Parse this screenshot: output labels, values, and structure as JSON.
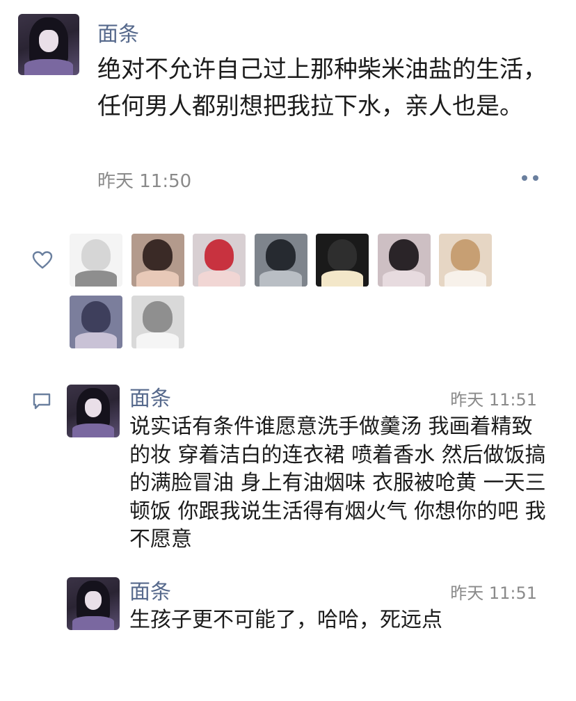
{
  "post": {
    "author": "面条",
    "text": "绝对不允许自己过上那种柴米油盐的生活，任何男人都别想把我拉下水，亲人也是。",
    "time": "昨天 11:50"
  },
  "likes": {
    "icon": "heart-outline-icon",
    "avatars": [
      {
        "name": "like-avatar-1",
        "colors": [
          "#f4f4f4",
          "#d6d6d6",
          "#8e8e8e"
        ]
      },
      {
        "name": "like-avatar-2",
        "colors": [
          "#b39a8c",
          "#3a2a26",
          "#e8c9b8"
        ]
      },
      {
        "name": "like-avatar-3",
        "colors": [
          "#d8cfd2",
          "#c8323f",
          "#f1d6d4"
        ]
      },
      {
        "name": "like-avatar-4",
        "colors": [
          "#7e848c",
          "#262a30",
          "#b9bec4"
        ]
      },
      {
        "name": "like-avatar-5",
        "colors": [
          "#1a1a1a",
          "#2e2e2e",
          "#f3e7c9"
        ]
      },
      {
        "name": "like-avatar-6",
        "colors": [
          "#cdbfc3",
          "#2a2428",
          "#e7dbdf"
        ]
      },
      {
        "name": "like-avatar-7",
        "colors": [
          "#e6d6c4",
          "#c79f73",
          "#f7f1ea"
        ]
      },
      {
        "name": "like-avatar-8",
        "colors": [
          "#7b7e9c",
          "#3e3f5c",
          "#c9c2d6"
        ]
      },
      {
        "name": "like-avatar-9",
        "colors": [
          "#d9d9d9",
          "#8f8f8f",
          "#f5f5f5"
        ]
      }
    ]
  },
  "comments": [
    {
      "author": "面条",
      "time": "昨天 11:51",
      "text": "说实话有条件谁愿意洗手做羹汤 我画着精致的妆 穿着洁白的连衣裙 喷着香水 然后做饭搞的满脸冒油 身上有油烟味 衣服被呛黄 一天三顿饭 你跟我说生活得有烟火气 你想你的吧 我不愿意"
    },
    {
      "author": "面条",
      "time": "昨天 11:51",
      "text": "生孩子更不可能了，哈哈，死远点"
    }
  ],
  "icons": {
    "more": "more-dots-icon",
    "comment": "comment-bubble-icon"
  }
}
